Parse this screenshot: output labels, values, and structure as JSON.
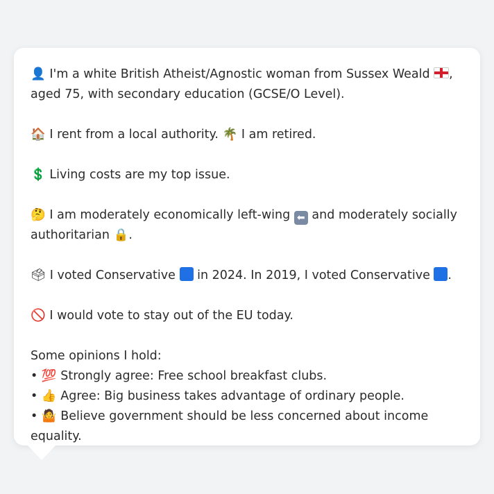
{
  "profile": {
    "line1_a": "I'm a white British Atheist/Agnostic woman from Sussex Weald",
    "line1_b": ", aged 75, with secondary education (GCSE/O Level).",
    "housing": "I rent from a local authority.",
    "work": "I am retired.",
    "top_issue": "Living costs are my top issue.",
    "position_a": "I am moderately economically left-wing",
    "position_b": "and moderately socially authoritarian",
    "position_end": ".",
    "vote_a": "I voted Conservative",
    "vote_b": "in 2024. In 2019, I voted Conservative",
    "vote_end": ".",
    "eu": "I would vote to stay out of the EU today."
  },
  "opinions": {
    "heading": "Some opinions I hold:",
    "items": [
      {
        "bullet": "•",
        "icon": "💯",
        "text": "Strongly agree: Free school breakfast clubs."
      },
      {
        "bullet": "•",
        "icon": "👍",
        "text": "Agree: Big business takes advantage of ordinary people."
      },
      {
        "bullet": "•",
        "icon": "🤷",
        "text": "Believe government should be less concerned about income equality."
      }
    ]
  },
  "icons": {
    "person": "👤",
    "house": "🏠",
    "palm": "🌴",
    "dollar": "💲",
    "thinking": "🤔",
    "left_arrow": "⬅",
    "lock": "🔒",
    "ballot": "🗳",
    "no_entry": "🚫"
  },
  "colors": {
    "conservative": "#1f6fe5",
    "arrow_box": "#7b8aa3",
    "flag_cross": "#d21f2c"
  }
}
